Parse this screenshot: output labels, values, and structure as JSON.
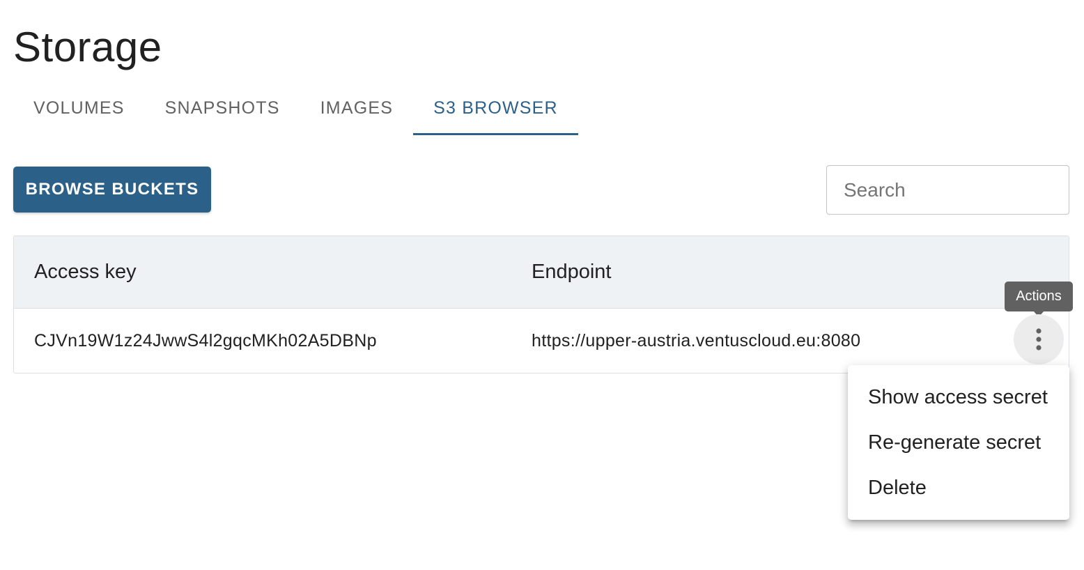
{
  "page": {
    "title": "Storage"
  },
  "tabs": [
    {
      "label": "VOLUMES",
      "active": false
    },
    {
      "label": "SNAPSHOTS",
      "active": false
    },
    {
      "label": "IMAGES",
      "active": false
    },
    {
      "label": "S3 BROWSER",
      "active": true
    }
  ],
  "toolbar": {
    "browse_label": "BROWSE BUCKETS",
    "search_placeholder": "Search",
    "search_value": ""
  },
  "table": {
    "headers": [
      "Access key",
      "Endpoint"
    ],
    "rows": [
      {
        "access_key": "CJVn19W1z24JwwS4l2gqcMKh02A5DBNp",
        "endpoint": "https://upper-austria.ventuscloud.eu:8080"
      }
    ]
  },
  "actions": {
    "tooltip": "Actions",
    "icon": "more-vert-icon",
    "menu": [
      {
        "label": "Show access secret"
      },
      {
        "label": "Re-generate secret"
      },
      {
        "label": "Delete"
      }
    ]
  },
  "colors": {
    "accent": "#2b6189",
    "header_bg": "#eef2f5",
    "tooltip_bg": "#616161"
  }
}
